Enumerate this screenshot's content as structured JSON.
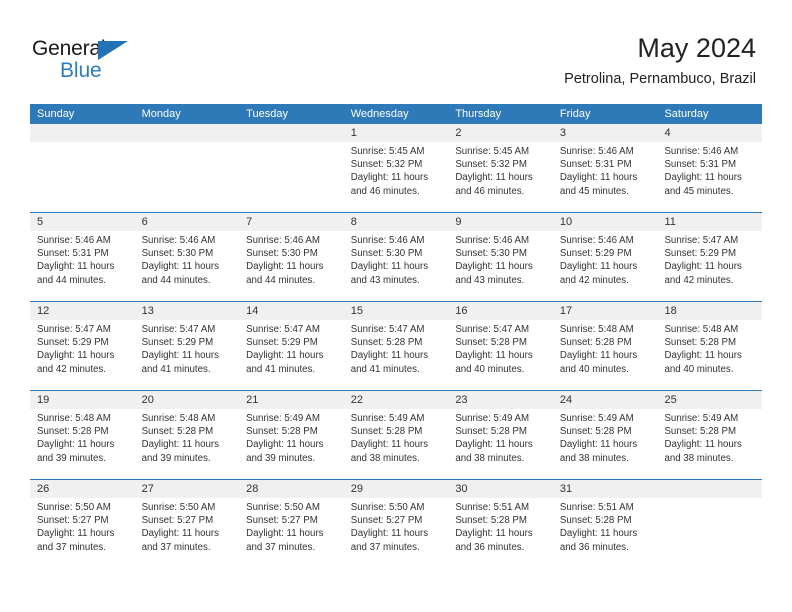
{
  "brand": {
    "name_top": "General",
    "name_bottom": "Blue",
    "accent_color": "#2e7ab8",
    "logo_triangle": "triangle-icon"
  },
  "header": {
    "title": "May 2024",
    "subtitle": "Petrolina, Pernambuco, Brazil"
  },
  "calendar": {
    "weekday_headers": [
      "Sunday",
      "Monday",
      "Tuesday",
      "Wednesday",
      "Thursday",
      "Friday",
      "Saturday"
    ],
    "header_bg": "#2e7ab8",
    "date_band_bg": "#f0f0f0",
    "weeks": [
      {
        "days": [
          {
            "date": "",
            "lines": []
          },
          {
            "date": "",
            "lines": []
          },
          {
            "date": "",
            "lines": []
          },
          {
            "date": "1",
            "lines": [
              "Sunrise: 5:45 AM",
              "Sunset: 5:32 PM",
              "Daylight: 11 hours",
              "and 46 minutes."
            ]
          },
          {
            "date": "2",
            "lines": [
              "Sunrise: 5:45 AM",
              "Sunset: 5:32 PM",
              "Daylight: 11 hours",
              "and 46 minutes."
            ]
          },
          {
            "date": "3",
            "lines": [
              "Sunrise: 5:46 AM",
              "Sunset: 5:31 PM",
              "Daylight: 11 hours",
              "and 45 minutes."
            ]
          },
          {
            "date": "4",
            "lines": [
              "Sunrise: 5:46 AM",
              "Sunset: 5:31 PM",
              "Daylight: 11 hours",
              "and 45 minutes."
            ]
          }
        ]
      },
      {
        "days": [
          {
            "date": "5",
            "lines": [
              "Sunrise: 5:46 AM",
              "Sunset: 5:31 PM",
              "Daylight: 11 hours",
              "and 44 minutes."
            ]
          },
          {
            "date": "6",
            "lines": [
              "Sunrise: 5:46 AM",
              "Sunset: 5:30 PM",
              "Daylight: 11 hours",
              "and 44 minutes."
            ]
          },
          {
            "date": "7",
            "lines": [
              "Sunrise: 5:46 AM",
              "Sunset: 5:30 PM",
              "Daylight: 11 hours",
              "and 44 minutes."
            ]
          },
          {
            "date": "8",
            "lines": [
              "Sunrise: 5:46 AM",
              "Sunset: 5:30 PM",
              "Daylight: 11 hours",
              "and 43 minutes."
            ]
          },
          {
            "date": "9",
            "lines": [
              "Sunrise: 5:46 AM",
              "Sunset: 5:30 PM",
              "Daylight: 11 hours",
              "and 43 minutes."
            ]
          },
          {
            "date": "10",
            "lines": [
              "Sunrise: 5:46 AM",
              "Sunset: 5:29 PM",
              "Daylight: 11 hours",
              "and 42 minutes."
            ]
          },
          {
            "date": "11",
            "lines": [
              "Sunrise: 5:47 AM",
              "Sunset: 5:29 PM",
              "Daylight: 11 hours",
              "and 42 minutes."
            ]
          }
        ]
      },
      {
        "days": [
          {
            "date": "12",
            "lines": [
              "Sunrise: 5:47 AM",
              "Sunset: 5:29 PM",
              "Daylight: 11 hours",
              "and 42 minutes."
            ]
          },
          {
            "date": "13",
            "lines": [
              "Sunrise: 5:47 AM",
              "Sunset: 5:29 PM",
              "Daylight: 11 hours",
              "and 41 minutes."
            ]
          },
          {
            "date": "14",
            "lines": [
              "Sunrise: 5:47 AM",
              "Sunset: 5:29 PM",
              "Daylight: 11 hours",
              "and 41 minutes."
            ]
          },
          {
            "date": "15",
            "lines": [
              "Sunrise: 5:47 AM",
              "Sunset: 5:28 PM",
              "Daylight: 11 hours",
              "and 41 minutes."
            ]
          },
          {
            "date": "16",
            "lines": [
              "Sunrise: 5:47 AM",
              "Sunset: 5:28 PM",
              "Daylight: 11 hours",
              "and 40 minutes."
            ]
          },
          {
            "date": "17",
            "lines": [
              "Sunrise: 5:48 AM",
              "Sunset: 5:28 PM",
              "Daylight: 11 hours",
              "and 40 minutes."
            ]
          },
          {
            "date": "18",
            "lines": [
              "Sunrise: 5:48 AM",
              "Sunset: 5:28 PM",
              "Daylight: 11 hours",
              "and 40 minutes."
            ]
          }
        ]
      },
      {
        "days": [
          {
            "date": "19",
            "lines": [
              "Sunrise: 5:48 AM",
              "Sunset: 5:28 PM",
              "Daylight: 11 hours",
              "and 39 minutes."
            ]
          },
          {
            "date": "20",
            "lines": [
              "Sunrise: 5:48 AM",
              "Sunset: 5:28 PM",
              "Daylight: 11 hours",
              "and 39 minutes."
            ]
          },
          {
            "date": "21",
            "lines": [
              "Sunrise: 5:49 AM",
              "Sunset: 5:28 PM",
              "Daylight: 11 hours",
              "and 39 minutes."
            ]
          },
          {
            "date": "22",
            "lines": [
              "Sunrise: 5:49 AM",
              "Sunset: 5:28 PM",
              "Daylight: 11 hours",
              "and 38 minutes."
            ]
          },
          {
            "date": "23",
            "lines": [
              "Sunrise: 5:49 AM",
              "Sunset: 5:28 PM",
              "Daylight: 11 hours",
              "and 38 minutes."
            ]
          },
          {
            "date": "24",
            "lines": [
              "Sunrise: 5:49 AM",
              "Sunset: 5:28 PM",
              "Daylight: 11 hours",
              "and 38 minutes."
            ]
          },
          {
            "date": "25",
            "lines": [
              "Sunrise: 5:49 AM",
              "Sunset: 5:28 PM",
              "Daylight: 11 hours",
              "and 38 minutes."
            ]
          }
        ]
      },
      {
        "days": [
          {
            "date": "26",
            "lines": [
              "Sunrise: 5:50 AM",
              "Sunset: 5:27 PM",
              "Daylight: 11 hours",
              "and 37 minutes."
            ]
          },
          {
            "date": "27",
            "lines": [
              "Sunrise: 5:50 AM",
              "Sunset: 5:27 PM",
              "Daylight: 11 hours",
              "and 37 minutes."
            ]
          },
          {
            "date": "28",
            "lines": [
              "Sunrise: 5:50 AM",
              "Sunset: 5:27 PM",
              "Daylight: 11 hours",
              "and 37 minutes."
            ]
          },
          {
            "date": "29",
            "lines": [
              "Sunrise: 5:50 AM",
              "Sunset: 5:27 PM",
              "Daylight: 11 hours",
              "and 37 minutes."
            ]
          },
          {
            "date": "30",
            "lines": [
              "Sunrise: 5:51 AM",
              "Sunset: 5:28 PM",
              "Daylight: 11 hours",
              "and 36 minutes."
            ]
          },
          {
            "date": "31",
            "lines": [
              "Sunrise: 5:51 AM",
              "Sunset: 5:28 PM",
              "Daylight: 11 hours",
              "and 36 minutes."
            ]
          },
          {
            "date": "",
            "lines": []
          }
        ]
      }
    ]
  }
}
